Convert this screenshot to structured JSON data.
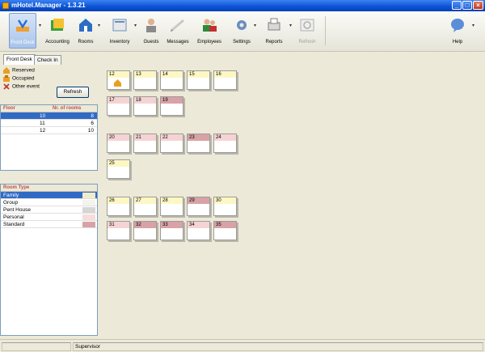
{
  "window": {
    "title": "mHotel.Manager - 1.3.21"
  },
  "toolbar": {
    "items": [
      {
        "label": "Front Desk",
        "icon": "front-desk-icon"
      },
      {
        "label": "Accounting",
        "icon": "accounting-icon"
      },
      {
        "label": "Rooms",
        "icon": "rooms-icon"
      },
      {
        "label": "Inventory",
        "icon": "inventory-icon"
      },
      {
        "label": "Guests",
        "icon": "guests-icon"
      },
      {
        "label": "Messages",
        "icon": "messages-icon"
      },
      {
        "label": "Employees",
        "icon": "employees-icon"
      },
      {
        "label": "Settings",
        "icon": "settings-icon"
      },
      {
        "label": "Reports",
        "icon": "reports-icon"
      },
      {
        "label": "Refresh",
        "icon": "refresh-icon"
      },
      {
        "label": "Help",
        "icon": "help-icon"
      }
    ]
  },
  "tabs": [
    {
      "label": "Front Desk"
    },
    {
      "label": "Check In"
    }
  ],
  "legend": {
    "reserved": "Reserved",
    "occupied": "Occupied",
    "other_event": "Other event",
    "refresh_button": "Refresh"
  },
  "floors": {
    "headers": {
      "floor": "Floor",
      "rooms": "Nr. of rooms"
    },
    "rows": [
      {
        "floor": "10",
        "rooms": "8"
      },
      {
        "floor": "11",
        "rooms": "6"
      },
      {
        "floor": "12",
        "rooms": "10"
      }
    ]
  },
  "room_types": {
    "header": "Room Type",
    "rows": [
      {
        "name": "Family",
        "color": "#f0ecc8"
      },
      {
        "name": "Group",
        "color": "#f4f3ee"
      },
      {
        "name": "Pent House",
        "color": "#d6d6d6"
      },
      {
        "name": "Personal",
        "color": "#f8dcdc"
      },
      {
        "name": "Standard",
        "color": "#d8a2a6"
      }
    ]
  },
  "rooms": [
    {
      "num": "12",
      "style": "yellow",
      "icon": "reserved-icon"
    },
    {
      "num": "13",
      "style": "yellow"
    },
    {
      "num": "14",
      "style": "yellow"
    },
    {
      "num": "15",
      "style": "yellow"
    },
    {
      "num": "16",
      "style": "yellow"
    },
    {
      "num": "17",
      "style": "pink"
    },
    {
      "num": "18",
      "style": "pink"
    },
    {
      "num": "19",
      "style": "rose"
    },
    {
      "num": "20",
      "style": "pink"
    },
    {
      "num": "21",
      "style": "pink"
    },
    {
      "num": "22",
      "style": "pink"
    },
    {
      "num": "23",
      "style": "rose"
    },
    {
      "num": "24",
      "style": "pink"
    },
    {
      "num": "25",
      "style": "yellow"
    },
    {
      "num": "26",
      "style": "yellow"
    },
    {
      "num": "27",
      "style": "yellow"
    },
    {
      "num": "28",
      "style": "yellow"
    },
    {
      "num": "29",
      "style": "rose"
    },
    {
      "num": "30",
      "style": "yellow"
    },
    {
      "num": "31",
      "style": "pink"
    },
    {
      "num": "32",
      "style": "rose"
    },
    {
      "num": "33",
      "style": "rose"
    },
    {
      "num": "34",
      "style": "pink"
    },
    {
      "num": "35",
      "style": "rose"
    }
  ],
  "status": {
    "user": "Supervisor"
  }
}
